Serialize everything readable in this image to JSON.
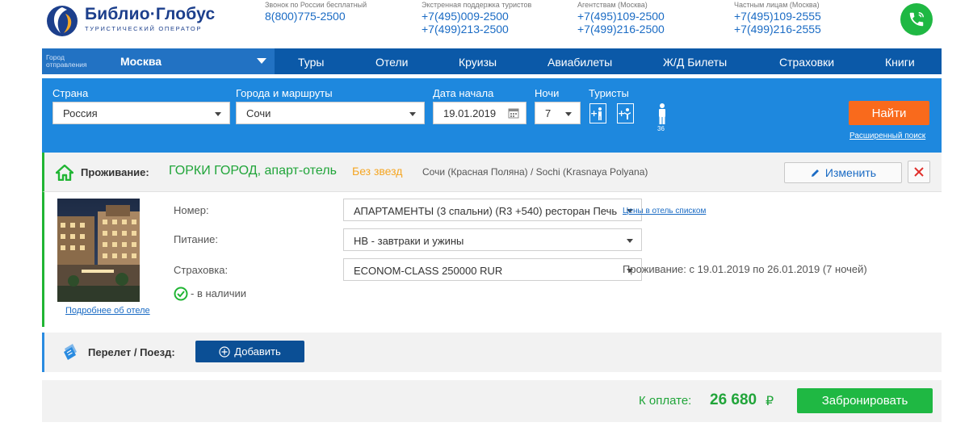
{
  "brand": {
    "name": "Библио·Глобус",
    "subtitle": "ТУРИСТИЧЕСКИЙ ОПЕРАТОР"
  },
  "contacts": [
    {
      "label": "Звонок по России бесплатный",
      "phones": [
        "8(800)775-2500"
      ]
    },
    {
      "label": "Экстренная поддержка туристов",
      "phones": [
        "+7(495)009-2500",
        "+7(499)213-2500"
      ]
    },
    {
      "label": "Агентствам (Москва)",
      "phones": [
        "+7(495)109-2500",
        "+7(499)216-2500"
      ]
    },
    {
      "label": "Частным лицам (Москва)",
      "phones": [
        "+7(495)109-2555",
        "+7(499)216-2555"
      ]
    }
  ],
  "nav": {
    "departure_label": "Город отправления",
    "departure_city": "Москва",
    "items": [
      "Туры",
      "Отели",
      "Круизы",
      "Авиабилеты",
      "Ж/Д Билеты",
      "Страховки",
      "Книги"
    ]
  },
  "search": {
    "country_label": "Страна",
    "country_value": "Россия",
    "cities_label": "Города и маршруты",
    "cities_value": "Сочи",
    "date_label": "Дата начала",
    "date_value": "19.01.2019",
    "nights_label": "Ночи",
    "nights_value": "7",
    "tourists_label": "Туристы",
    "tourist_age": "36",
    "find_label": "Найти",
    "advanced_label": "Расширенный поиск"
  },
  "accommodation": {
    "section_label": "Проживание:",
    "hotel_name": "ГОРКИ ГОРОД, апарт-отель",
    "stars": "Без звезд",
    "location": "Сочи (Красная Поляна) / Sochi (Krasnaya Polyana)",
    "change_label": "Изменить",
    "room_label": "Номер:",
    "room_value": "АПАРТАМЕНТЫ (3 спальни) (R3 +540) ресторан Печь",
    "meal_label": "Питание:",
    "meal_value": "HB - завтраки и ужины",
    "insurance_label": "Страховка:",
    "insurance_value": "ECONOM-CLASS 250000 RUR",
    "availability": "- в наличии",
    "prices_link": "Цены в отель списком",
    "stay_text": "Проживание: с 19.01.2019 по 26.01.2019 (7 ночей)",
    "more_link": "Подробнее об отеле"
  },
  "flight": {
    "label": "Перелет / Поезд:",
    "add_label": "Добавить"
  },
  "payment": {
    "label": "К оплате:",
    "amount": "26 680",
    "currency": "₽",
    "book_label": "Забронировать"
  },
  "colors": {
    "nav_bg": "#0b59a8",
    "search_bg": "#1e88de",
    "accent_orange": "#f96a1c",
    "accent_green": "#1fb843",
    "hotel_green": "#21b534",
    "stars_orange": "#f5a623"
  }
}
